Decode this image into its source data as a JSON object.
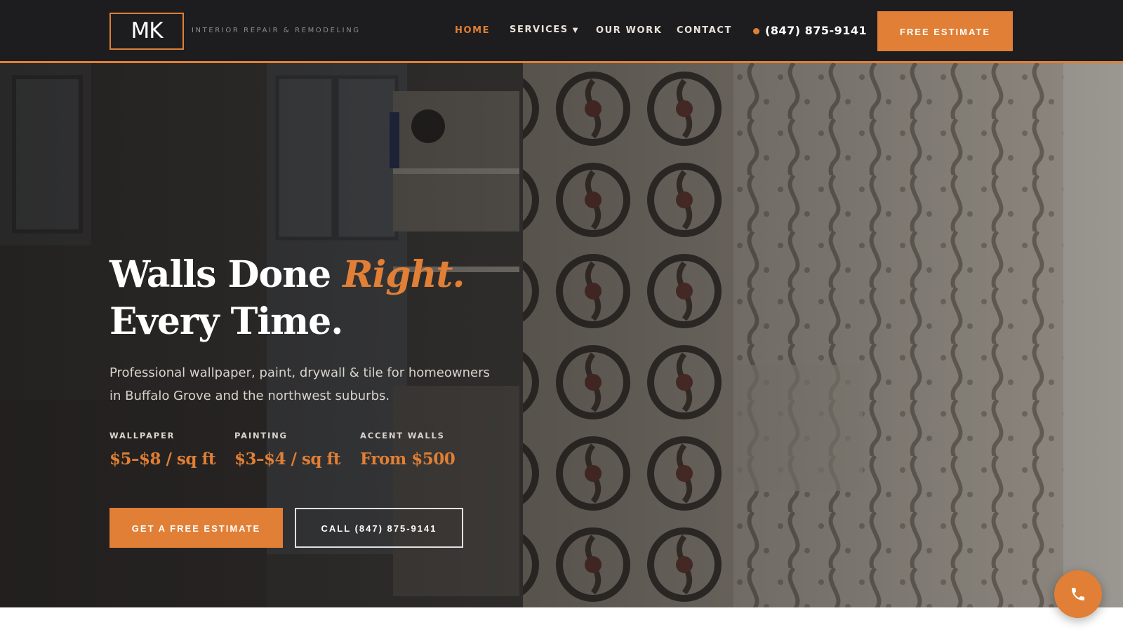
{
  "brand": {
    "logo_text": "MK",
    "tagline": "INTERIOR REPAIR & REMODELING"
  },
  "nav": {
    "items": [
      {
        "label": "HOME",
        "active": true
      },
      {
        "label": "SERVICES",
        "has_dropdown": true
      },
      {
        "label": "OUR WORK"
      },
      {
        "label": "CONTACT"
      }
    ],
    "dropdown_caret": "▼",
    "phone": "(847) 875-9141",
    "cta_label": "FREE ESTIMATE"
  },
  "hero": {
    "headline_part1": "Walls Done ",
    "headline_accent": "Right.",
    "headline_line2": "Every Time.",
    "subhead": "Professional wallpaper, paint, drywall & tile for homeowners in Buffalo Grove and the northwest suburbs.",
    "prices": [
      {
        "label": "WALLPAPER",
        "value": "$5–$8 / sq ft"
      },
      {
        "label": "PAINTING",
        "value": "$3–$4 / sq ft"
      },
      {
        "label": "ACCENT WALLS",
        "value": "From $500"
      }
    ],
    "primary_button": "GET A FREE ESTIMATE",
    "secondary_button": "CALL (847) 875-9141"
  },
  "floating": {
    "icon": "phone-icon"
  },
  "colors": {
    "accent": "#e07f35",
    "nav_bg": "#1d1d1f",
    "text_light": "#d8d3cb"
  }
}
